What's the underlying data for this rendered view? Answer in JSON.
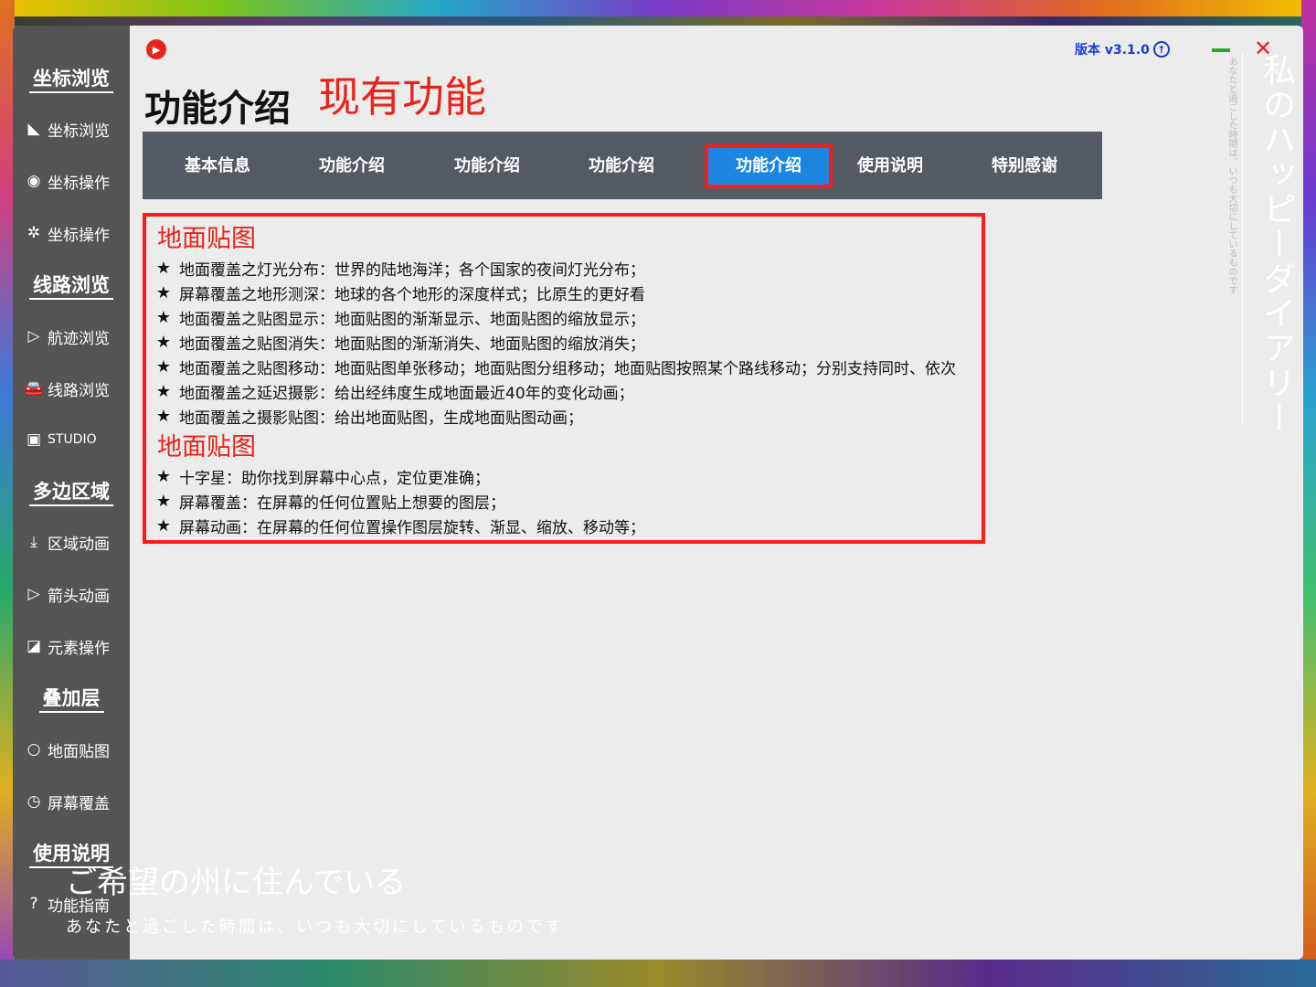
{
  "header": {
    "title": "功能介绍",
    "subtitle": "现有功能",
    "version": "版本 v3.1.0"
  },
  "sidebar": {
    "sections": [
      {
        "title": "坐标浏览",
        "items": [
          {
            "label": "坐标浏览",
            "icon": "compass-icon",
            "glyph": "◣"
          },
          {
            "label": "坐标操作",
            "icon": "target-icon",
            "glyph": "◉"
          },
          {
            "label": "坐标操作",
            "icon": "network-icon",
            "glyph": "✲"
          }
        ]
      },
      {
        "title": "线路浏览",
        "items": [
          {
            "label": "航迹浏览",
            "icon": "arrow-icon",
            "glyph": "▷"
          },
          {
            "label": "线路浏览",
            "icon": "car-icon",
            "glyph": "🚘"
          },
          {
            "label": "STUDIO",
            "icon": "camera-icon",
            "glyph": "▣"
          }
        ]
      },
      {
        "title": "多边区域",
        "items": [
          {
            "label": "区域动画",
            "icon": "download-icon",
            "glyph": "⤓"
          },
          {
            "label": "箭头动画",
            "icon": "arrow-icon",
            "glyph": "▷"
          },
          {
            "label": "元素操作",
            "icon": "edit-icon",
            "glyph": "◪"
          }
        ]
      },
      {
        "title": "叠加层",
        "items": [
          {
            "label": "地面贴图",
            "icon": "circle-icon",
            "glyph": "○"
          },
          {
            "label": "屏幕覆盖",
            "icon": "clock-icon",
            "glyph": "◷"
          }
        ]
      },
      {
        "title": "使用说明",
        "items": [
          {
            "label": "功能指南",
            "icon": "question-icon",
            "glyph": "?"
          }
        ]
      }
    ]
  },
  "tabs": [
    {
      "label": "基本信息",
      "active": false
    },
    {
      "label": "功能介绍",
      "active": false
    },
    {
      "label": "功能介绍",
      "active": false
    },
    {
      "label": "功能介绍",
      "active": false
    },
    {
      "label": "功能介绍",
      "active": true
    },
    {
      "label": "使用说明",
      "active": false
    },
    {
      "label": "特别感谢",
      "active": false
    }
  ],
  "content": {
    "section1_title": "地面贴图",
    "section1_lines": [
      "地面覆盖之灯光分布：世界的陆地海洋；各个国家的夜间灯光分布；",
      "屏幕覆盖之地形测深：地球的各个地形的深度样式；比原生的更好看",
      "地面覆盖之贴图显示：地面贴图的渐渐显示、地面贴图的缩放显示；",
      "地面覆盖之贴图消失：地面贴图的渐渐消失、地面贴图的缩放消失；",
      "地面覆盖之贴图移动：地面贴图单张移动；地面贴图分组移动；地面贴图按照某个路线移动；分别支持同时、依次",
      "地面覆盖之延迟摄影：给出经纬度生成地面最近40年的变化动画；",
      "地面覆盖之摄影贴图：给出地面贴图，生成地面贴图动画；"
    ],
    "section2_title": "地面贴图",
    "section2_lines": [
      "十字星：助你找到屏幕中心点，定位更准确；",
      "屏幕覆盖：在屏幕的任何位置贴上想要的图层；",
      "屏幕动画：在屏幕的任何位置操作图层旋转、渐显、缩放、移动等；"
    ]
  },
  "overlay": {
    "vertical_big": "私のハッピーダイアリー",
    "vertical_small": "あなたと過ごした時間は、いつも大切にしているものです",
    "bottom_big": "ご希望の州に住んでいる",
    "bottom_small": "あなたと過ごした時間は、いつも大切にしているものです"
  },
  "colors": {
    "accent_red": "#e8231a",
    "tab_active": "#1a86e0",
    "sidebar_bg": "#545454",
    "tabbar_bg": "#545a62"
  }
}
